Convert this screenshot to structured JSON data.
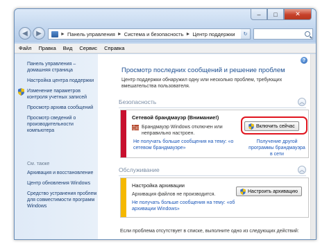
{
  "window": {
    "caption": {
      "minimize": "–",
      "maximize": "□",
      "close": "✕"
    }
  },
  "address": {
    "crumbs": [
      "Панель управления",
      "Система и безопасность",
      "Центр поддержки"
    ],
    "separator": "►"
  },
  "menu": [
    "Файл",
    "Правка",
    "Вид",
    "Сервис",
    "Справка"
  ],
  "sidebar": {
    "links": [
      "Панель управления – домашняя страница",
      "Настройка центра поддержки",
      "Изменение параметров контроля учетных записей",
      "Просмотр архива сообщений",
      "Просмотр сведений о производительности компьютера"
    ],
    "see_also_header": "См. также",
    "see_also": [
      "Архивация и восстановление",
      "Центр обновления Windows",
      "Средство устранения проблем для совместимости программ Windows"
    ]
  },
  "main": {
    "title": "Просмотр последних сообщений и решение проблем",
    "description": "Центр поддержки обнаружил одну или несколько проблем, требующих вмешательства пользователя.",
    "help": "?",
    "footer": "Если проблема отсутствует в списке, выполните одно из следующих действий:"
  },
  "security": {
    "header": "Безопасность",
    "alert_title": "Сетевой брандмауэр (Внимание!)",
    "alert_text": "Брандмауэр Windows отключен или неправильно настроен.",
    "dismiss_link": "Не получать больше сообщения на тему: «о сетевом брандмауэре»",
    "action_button": "Включить сейчас",
    "other_link": "Получение другой программы брандмауэра в сети",
    "bar_color": "#c8102e"
  },
  "maintenance": {
    "header": "Обслуживание",
    "alert_title": "Настройка архивации",
    "alert_text": "Архивация файлов не производится.",
    "dismiss_link": "Не получать больше сообщения на тему: «об архивации Windows»",
    "action_button": "Настроить архивацию",
    "bar_color": "#f5b800"
  },
  "colors": {
    "highlight": "#e0141e",
    "link": "#1a56b8",
    "title": "#1d4f91"
  }
}
